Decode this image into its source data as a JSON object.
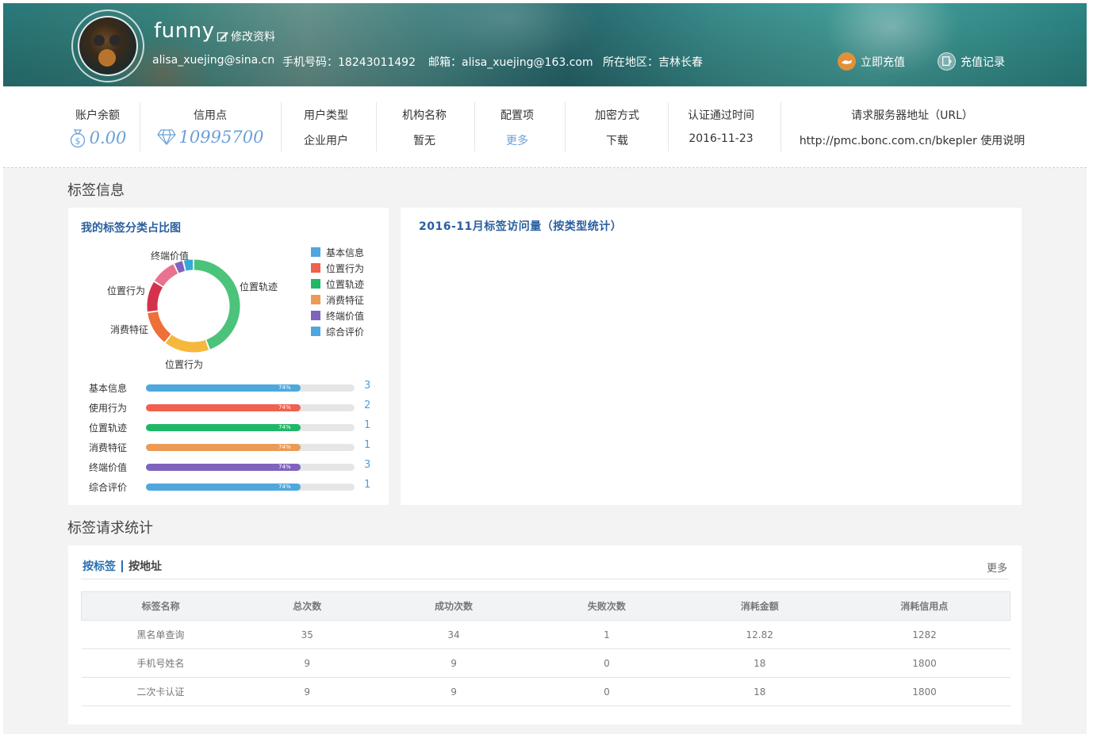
{
  "header": {
    "user_name": "funny",
    "edit_label": "修改资料",
    "account": "alisa_xuejing@sina.cn",
    "phone": "手机号码：18243011492",
    "email": "邮箱：alisa_xuejing@163.com",
    "region": "所在地区：吉林长春",
    "recharge_label": "立即充值",
    "records_label": "充值记录"
  },
  "stats": {
    "balance_label": "账户余额",
    "balance_value": "0.00",
    "credit_label": "信用点",
    "credit_value": "10995700",
    "user_type_label": "用户类型",
    "user_type_value": "企业用户",
    "org_label": "机构名称",
    "org_value": "暂无",
    "config_label": "配置项",
    "config_value": "更多",
    "encrypt_label": "加密方式",
    "encrypt_value": "下载",
    "auth_label": "认证通过时间",
    "auth_value": "2016-11-23",
    "url_label": "请求服务器地址（URL）",
    "url_value": "http://pmc.bonc.com.cn/bkepler 使用说明"
  },
  "tag_info": {
    "section_title": "标签信息",
    "pie_card_title": "我的标签分类占比图",
    "visit_card_title": "2016-11月标签访问量（按类型统计）",
    "legend": [
      {
        "label": "基本信息",
        "color": "#4ea8de"
      },
      {
        "label": "位置行为",
        "color": "#f0614f"
      },
      {
        "label": "位置轨迹",
        "color": "#1fb868"
      },
      {
        "label": "消费特征",
        "color": "#eb9b55"
      },
      {
        "label": "终端价值",
        "color": "#7f63bd"
      },
      {
        "label": "综合评价",
        "color": "#4ea8de"
      }
    ],
    "donut_labels": {
      "top": "终端价值",
      "right": "位置轨迹",
      "left_top": "位置行为",
      "left_mid": "消费特征",
      "bottom": "位置行为"
    },
    "bars": [
      {
        "label": "基本信息",
        "pct_text": "74%",
        "pct": 0.74,
        "count": "3",
        "color": "#4ea8de"
      },
      {
        "label": "使用行为",
        "pct_text": "74%",
        "pct": 0.74,
        "count": "2",
        "color": "#f0614f"
      },
      {
        "label": "位置轨迹",
        "pct_text": "74%",
        "pct": 0.74,
        "count": "1",
        "color": "#1fb868"
      },
      {
        "label": "消费特征",
        "pct_text": "74%",
        "pct": 0.74,
        "count": "1",
        "color": "#eb9b55"
      },
      {
        "label": "终端价值",
        "pct_text": "74%",
        "pct": 0.74,
        "count": "3",
        "color": "#7f63bd"
      },
      {
        "label": "综合评价",
        "pct_text": "74%",
        "pct": 0.74,
        "count": "1",
        "color": "#4ea8de"
      }
    ]
  },
  "requests": {
    "section_title": "标签请求统计",
    "tab_active": "按标签",
    "tab_inactive": "按地址",
    "more": "更多",
    "columns": [
      "标签名称",
      "总次数",
      "成功次数",
      "失败次数",
      "消耗金额",
      "消耗信用点"
    ],
    "rows": [
      [
        "黑名单查询",
        "35",
        "34",
        "1",
        "12.82",
        "1282"
      ],
      [
        "手机号姓名",
        "9",
        "9",
        "0",
        "18",
        "1800"
      ],
      [
        "二次卡认证",
        "9",
        "9",
        "0",
        "18",
        "1800"
      ]
    ]
  }
}
